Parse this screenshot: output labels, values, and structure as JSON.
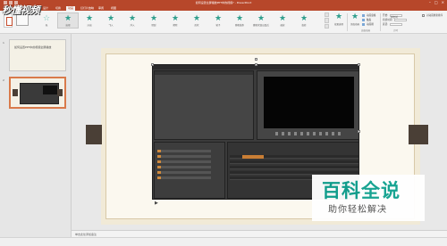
{
  "title_bar": {
    "title": "如何设置全屏播放PPT中的视频? - PowerPoint"
  },
  "tabs": [
    "文件",
    "开始",
    "插入",
    "设计",
    "切换",
    "动画",
    "幻灯片放映",
    "审阅",
    "视图"
  ],
  "animation_gallery": [
    {
      "label": "无",
      "icon": "none"
    },
    {
      "label": "出现",
      "icon": "star-icon"
    },
    {
      "label": "淡出",
      "icon": "star-icon"
    },
    {
      "label": "飞入",
      "icon": "star-icon"
    },
    {
      "label": "浮入",
      "icon": "star-icon"
    },
    {
      "label": "劈裂",
      "icon": "star-icon"
    },
    {
      "label": "擦除",
      "icon": "star-icon"
    },
    {
      "label": "形状",
      "icon": "star-icon"
    },
    {
      "label": "轮子",
      "icon": "star-icon"
    },
    {
      "label": "随机线条",
      "icon": "star-icon"
    },
    {
      "label": "翻转式由远及近",
      "icon": "star-icon"
    },
    {
      "label": "缩放",
      "icon": "star-icon"
    },
    {
      "label": "旋转",
      "icon": "star-icon"
    }
  ],
  "ribbon_right": {
    "effect_options": "效果选项",
    "add_animation": "添加动画",
    "pane": "动画窗格",
    "trigger": "触发",
    "painter": "动画刷",
    "start_label": "开始:",
    "start_value": "单击时",
    "duration_label": "持续时间:",
    "delay_label": "延迟:",
    "reorder": "对动画重新排序",
    "group_advanced": "高级动画",
    "group_timing": "计时"
  },
  "thumbnails": [
    {
      "num": "1",
      "text": "如何设置PPT中的视频全屏播放"
    },
    {
      "num": "2",
      "text": ""
    }
  ],
  "notes_placeholder": "单击此处添加备注",
  "play_icon": "play-icon",
  "logo_text": "秒懂视频",
  "watermark": {
    "big": "百科全说",
    "small": "助你轻松解决"
  },
  "colors": {
    "accent": "#b7472a",
    "teal": "#0fa18f",
    "slide_bg": "#f1ead7",
    "side_tab": "#4a3f36"
  }
}
